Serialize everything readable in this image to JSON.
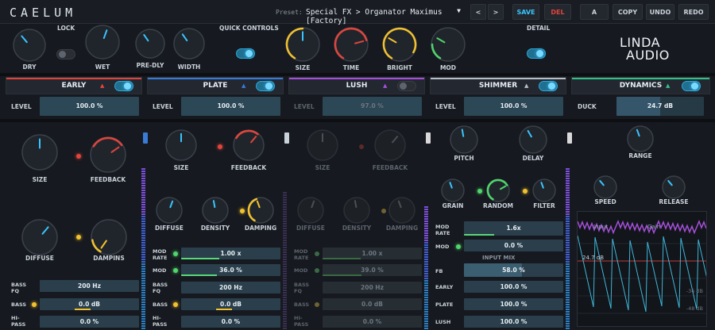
{
  "app": {
    "logo": "CAELUM",
    "brand_line1": "LINDA",
    "brand_line2": "AUDIO"
  },
  "toolbar": {
    "preset_label": "Preset:",
    "preset_value": "Special FX > Organator Maximus [Factory]",
    "prev": "<",
    "next": ">",
    "save": "SAVE",
    "del": "DEL",
    "a": "A",
    "copy": "COPY",
    "undo": "UNDO",
    "redo": "REDO"
  },
  "quick": {
    "dry": "DRY",
    "lock": "LOCK",
    "wet": "WET",
    "predly": "PRE-DLY",
    "width": "WIDTH",
    "quick_controls": "QUICK CONTROLS",
    "size": "SIZE",
    "time": "TIME",
    "bright": "BRIGHT",
    "mod": "MOD",
    "detail": "DETAIL"
  },
  "modules": {
    "early": {
      "title": "EARLY",
      "level_label": "LEVEL",
      "level": "100.0 %",
      "size": "SIZE",
      "feedback": "FEEDBACK",
      "diffuse": "DIFFUSE",
      "dampins": "DAMPINS",
      "bass_fq_label_1": "BASS",
      "bass_fq_label_2": "FQ",
      "bass_fq": "200 Hz",
      "bass_label": "BASS",
      "bass": "0.0 dB",
      "hipass_label_1": "HI-",
      "hipass_label_2": "PASS",
      "hipass": "0.0 %"
    },
    "plate": {
      "title": "PLATE",
      "level_label": "LEVEL",
      "level": "100.0 %",
      "size": "SIZE",
      "feedback": "FEEDBACK",
      "diffuse": "DIFFUSE",
      "density": "DENSITY",
      "damping": "DAMPING",
      "modrate_label_1": "MOD",
      "modrate_label_2": "RATE",
      "modrate": "1.00 x",
      "mod_label": "MOD",
      "mod": "36.0 %",
      "bassfq_label_1": "BASS",
      "bassfq_label_2": "FQ",
      "bassfq": "200 Hz",
      "bass_label": "BASS",
      "bass": "0.0 dB",
      "hipass_label_1": "HI-",
      "hipass_label_2": "PASS",
      "hipass": "0.0 %"
    },
    "lush": {
      "title": "LUSH",
      "level_label": "LEVEL",
      "level": "97.0 %",
      "size": "SIZE",
      "feedback": "FEEDBACK",
      "diffuse": "DIFFUSE",
      "density": "DENSITY",
      "damping": "DAMPING",
      "modrate_label_1": "MOD",
      "modrate_label_2": "RATE",
      "modrate": "1.00 x",
      "mod_label": "MOD",
      "mod": "39.0 %",
      "bassfq_label_1": "BASS",
      "bassfq_label_2": "FQ",
      "bassfq": "200 Hz",
      "bass_label": "BASS",
      "bass": "0.0 dB",
      "hipass_label_1": "HI-",
      "hipass_label_2": "PASS",
      "hipass": "0.0 %"
    },
    "shimmer": {
      "title": "SHIMMER",
      "level_label": "LEVEL",
      "level": "100.0 %",
      "pitch": "PITCH",
      "delay": "DELAY",
      "grain": "GRAIN",
      "random": "RANDOM",
      "filter": "FILTER",
      "modrate_label_1": "MOD",
      "modrate_label_2": "RATE",
      "modrate": "1.6x",
      "mod_label": "MOD",
      "mod": "0.0 %",
      "input_mix": "INPUT MIX",
      "fb_label": "FB",
      "fb": "58.0 %",
      "early_label": "EARLY",
      "early": "100.0 %",
      "plate_label": "PLATE",
      "plate": "100.0 %",
      "lush_label": "LUSH",
      "lush": "100.0 %"
    },
    "dynamics": {
      "title": "DYNAMICS",
      "duck_label": "DUCK",
      "duck": "24.7 dB",
      "range": "RANGE",
      "speed": "SPEED",
      "release": "RELEASE",
      "scope_input": "Input",
      "scope_gain": "Gain",
      "scope_db": "24.7 dB",
      "scope_m": "-36 dB",
      "scope_b": "-48 dB"
    }
  },
  "levels": {
    "early_level": 1.0,
    "plate_level": 1.0,
    "lush_level": 0.97,
    "shimmer_level": 1.0,
    "modrate_fill": 0.45,
    "mod_fill": 0.36,
    "lush_mod_fill": 0.39,
    "duck_fill": 0.5,
    "shimmer_modrate_fill": 0.32,
    "fb_fill": 0.58
  },
  "colors": {
    "accent_blue": "#39c5ff",
    "early": "#e0453c",
    "plate": "#3a7bd5",
    "lush": "#a64fd9",
    "shimmer": "#b8bec6",
    "dynamics": "#35c08a",
    "save": "#39c5ff",
    "del": "#e0453c"
  }
}
